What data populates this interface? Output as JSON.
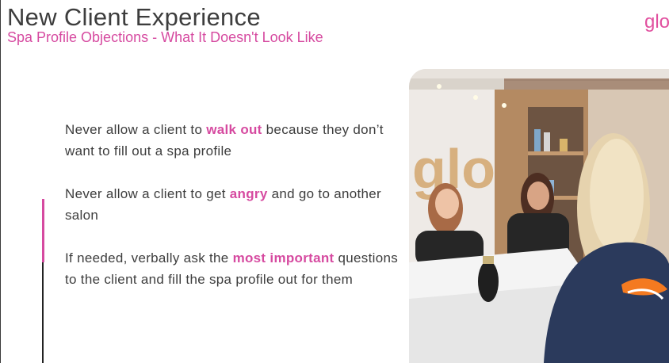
{
  "header": {
    "title": "New Client Experience",
    "subtitle": "Spa Profile Objections - What It Doesn't Look Like",
    "logo": "glo"
  },
  "points": [
    {
      "before": "Never allow a client to ",
      "highlight": "walk out",
      "after": " because they don’t want to fill out a spa profile"
    },
    {
      "before": "Never allow a client to get ",
      "highlight": "angry",
      "after": " and go to another salon"
    },
    {
      "before": "If needed, verbally ask the ",
      "highlight": "most important",
      "after": " questions to the client and fill the spa profile out for them"
    }
  ],
  "photo": {
    "wall_sign": "glo"
  },
  "colors": {
    "accent": "#d64aa0",
    "text": "#3d3d3d"
  }
}
